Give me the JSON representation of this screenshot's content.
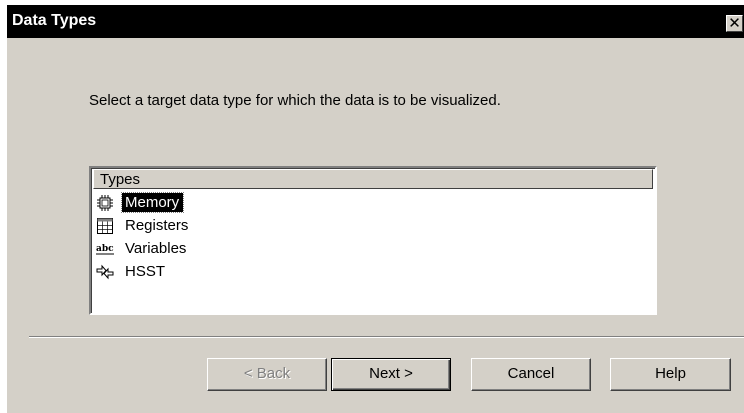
{
  "window": {
    "title": "Data Types",
    "close_glyph": "✕"
  },
  "instruction": "Select a target data type for which the data is to be visualized.",
  "types_list": {
    "header": "Types",
    "items": [
      {
        "label": "Memory",
        "icon": "memory-chip-icon",
        "selected": true
      },
      {
        "label": "Registers",
        "icon": "registers-grid-icon",
        "selected": false
      },
      {
        "label": "Variables",
        "icon": "abc-variables-icon",
        "selected": false
      },
      {
        "label": "HSST",
        "icon": "hsst-arrows-icon",
        "selected": false
      }
    ]
  },
  "buttons": {
    "back": "< Back",
    "next": "Next >",
    "cancel": "Cancel",
    "help": "Help"
  },
  "colors": {
    "dialog_bg": "#d4d0c8",
    "titlebar_bg": "#000000",
    "selection_bg": "#000000",
    "disabled_text": "#808080"
  }
}
